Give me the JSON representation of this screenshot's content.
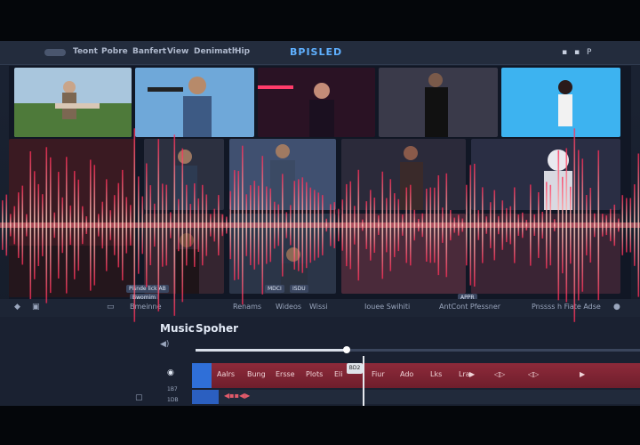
{
  "app": {
    "title": "BPISLED",
    "menu": [
      "Teont",
      "Pobre",
      "Banfert",
      "View",
      "Denimath",
      "Hip"
    ],
    "window_controls": [
      "▪",
      "▪",
      "P"
    ]
  },
  "media_grid": {
    "labels": [
      "Pisnde lick AB",
      "Bwomim",
      "MDCI",
      "ISDU",
      "APPR"
    ]
  },
  "tabs": [
    "Bmeinne",
    "Renams",
    "Wideos",
    "Wissi",
    "Iouee Swihiti",
    "AntCont Pfessner",
    "Pnssss h Fiate Adse"
  ],
  "timeline": {
    "title_left": "Music",
    "title_right": "Spoher",
    "clips": [
      "Aalrs",
      "Bung",
      "Ersse",
      "Plots",
      "Eli",
      "Fiur",
      "Ado",
      "Lks",
      "Lra"
    ],
    "playhead_tag": "BD2",
    "progress_fraction": 0.34,
    "row_labels": [
      "1B7",
      "1DB"
    ]
  },
  "colors": {
    "accent": "#5fb0ff",
    "waveform": "#ff4a6a",
    "track": "#8d2a3a"
  }
}
